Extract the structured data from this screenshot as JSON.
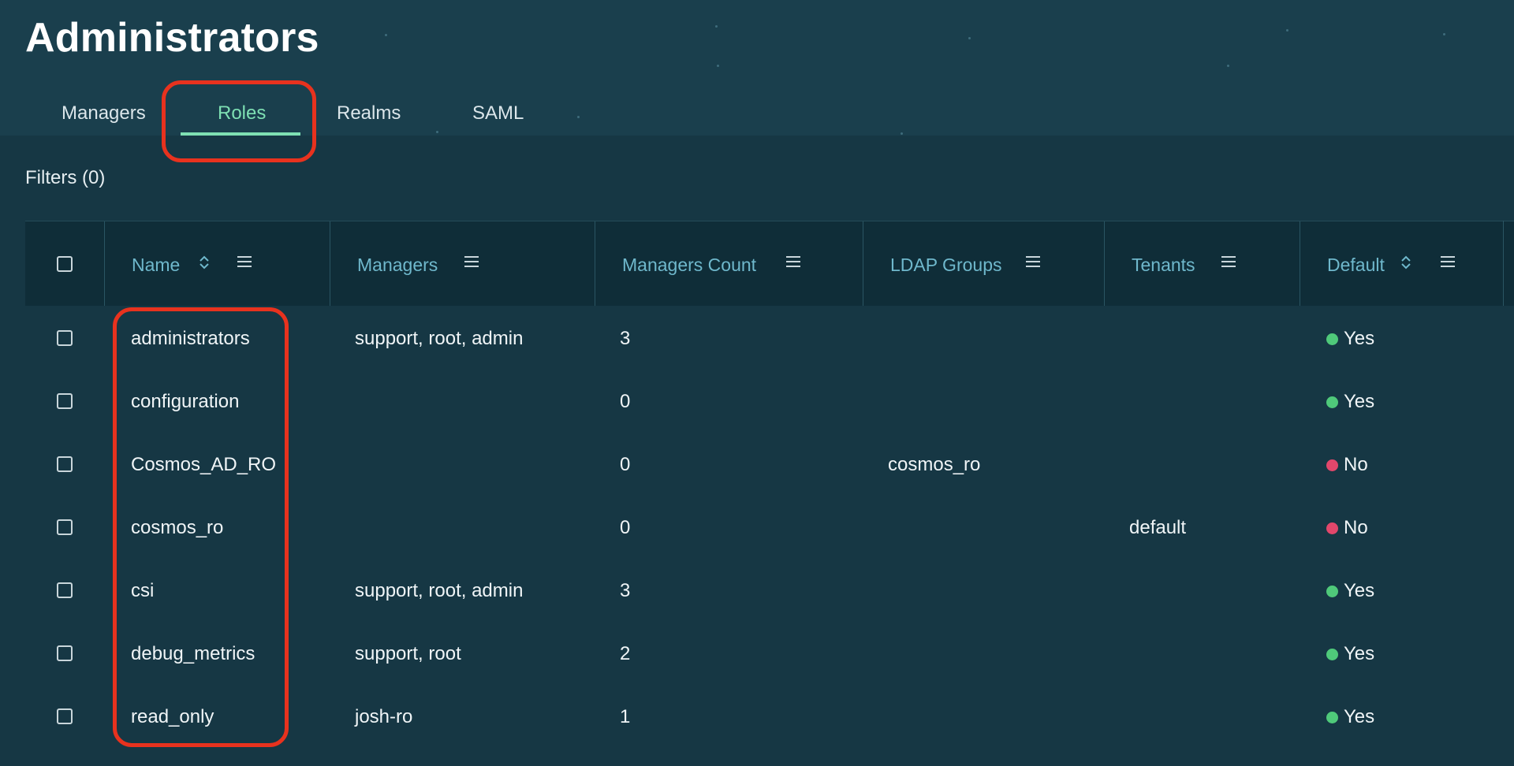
{
  "page": {
    "title": "Administrators"
  },
  "tabs": [
    {
      "label": "Managers",
      "active": false
    },
    {
      "label": "Roles",
      "active": true
    },
    {
      "label": "Realms",
      "active": false
    },
    {
      "label": "SAML",
      "active": false
    }
  ],
  "filters": {
    "label": "Filters (0)"
  },
  "table": {
    "columns": [
      {
        "label": "Name",
        "sortable": true,
        "menu_icon": "column-menu-icon"
      },
      {
        "label": "Managers",
        "sortable": false,
        "menu_icon": "column-menu-icon"
      },
      {
        "label": "Managers Count",
        "sortable": false,
        "menu_icon": "column-menu-icon"
      },
      {
        "label": "LDAP Groups",
        "sortable": false,
        "menu_icon": "column-menu-icon"
      },
      {
        "label": "Tenants",
        "sortable": false,
        "menu_icon": "column-menu-icon"
      },
      {
        "label": "Default",
        "sortable": true,
        "menu_icon": "column-menu-icon"
      }
    ],
    "rows": [
      {
        "name": "administrators",
        "managers": "support, root, admin",
        "managers_count": "3",
        "ldap_groups": "",
        "tenants": "",
        "default": "Yes"
      },
      {
        "name": "configuration",
        "managers": "",
        "managers_count": "0",
        "ldap_groups": "",
        "tenants": "",
        "default": "Yes"
      },
      {
        "name": "Cosmos_AD_RO",
        "managers": "",
        "managers_count": "0",
        "ldap_groups": "cosmos_ro",
        "tenants": "",
        "default": "No"
      },
      {
        "name": "cosmos_ro",
        "managers": "",
        "managers_count": "0",
        "ldap_groups": "",
        "tenants": "default",
        "default": "No"
      },
      {
        "name": "csi",
        "managers": "support, root, admin",
        "managers_count": "3",
        "ldap_groups": "",
        "tenants": "",
        "default": "Yes"
      },
      {
        "name": "debug_metrics",
        "managers": "support, root",
        "managers_count": "2",
        "ldap_groups": "",
        "tenants": "",
        "default": "Yes"
      },
      {
        "name": "read_only",
        "managers": "josh-ro",
        "managers_count": "1",
        "ldap_groups": "",
        "tenants": "",
        "default": "Yes"
      }
    ]
  },
  "colors": {
    "accent": "#7ee0b3",
    "yes_dot": "#4fc97a",
    "no_dot": "#e2476b",
    "annotation": "#e8321e",
    "header_text": "#6fb8cc"
  }
}
